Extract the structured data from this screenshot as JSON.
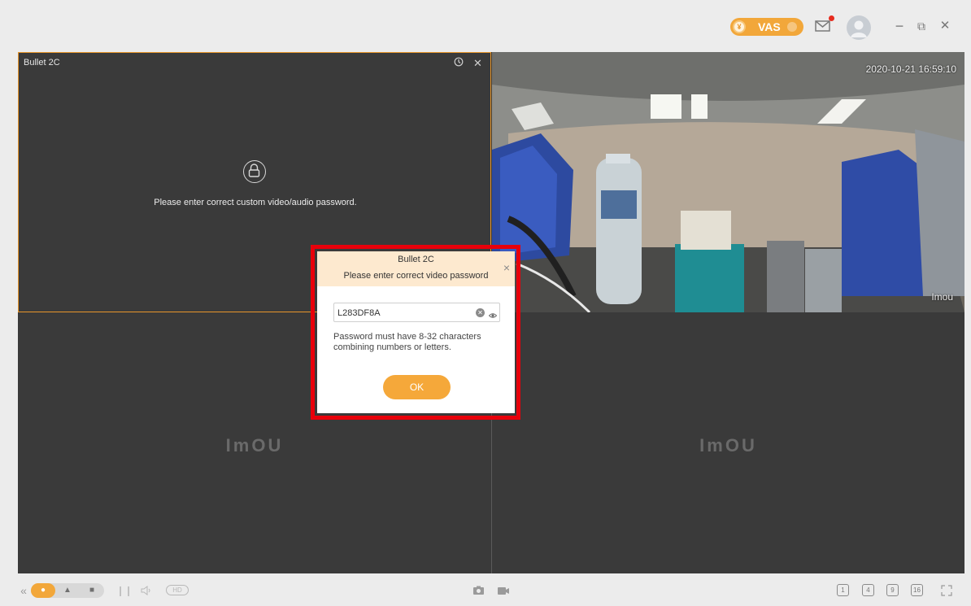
{
  "topbar": {
    "vas_label": "VAS",
    "coin_glyph": "¥",
    "accent_color": "#f2a73a",
    "notification_color": "#e62b1e",
    "window_controls": {
      "minimize": "−",
      "restore": "⧉",
      "close": "✕"
    }
  },
  "grid": {
    "cells": [
      {
        "title": "Bullet 2C",
        "message": "Please enter correct custom video/audio password.",
        "selected": true
      },
      {
        "timestamp": "2020-10-21 16:59:10",
        "watermark": "Imou"
      },
      {
        "brand": "ImOU"
      },
      {
        "brand": "ImOU"
      }
    ]
  },
  "dialog": {
    "title": "Bullet 2C",
    "subtitle": "Please enter correct video password",
    "close_glyph": "×",
    "password_value": "L283DF8A",
    "hint": "Password must have 8-32 characters combining numbers or letters.",
    "ok_label": "OK",
    "highlight_color": "#e8000b"
  },
  "bottombar": {
    "collapse_glyph": "«",
    "hd_label": "HD",
    "layouts": [
      "1",
      "4",
      "9",
      "16"
    ]
  }
}
